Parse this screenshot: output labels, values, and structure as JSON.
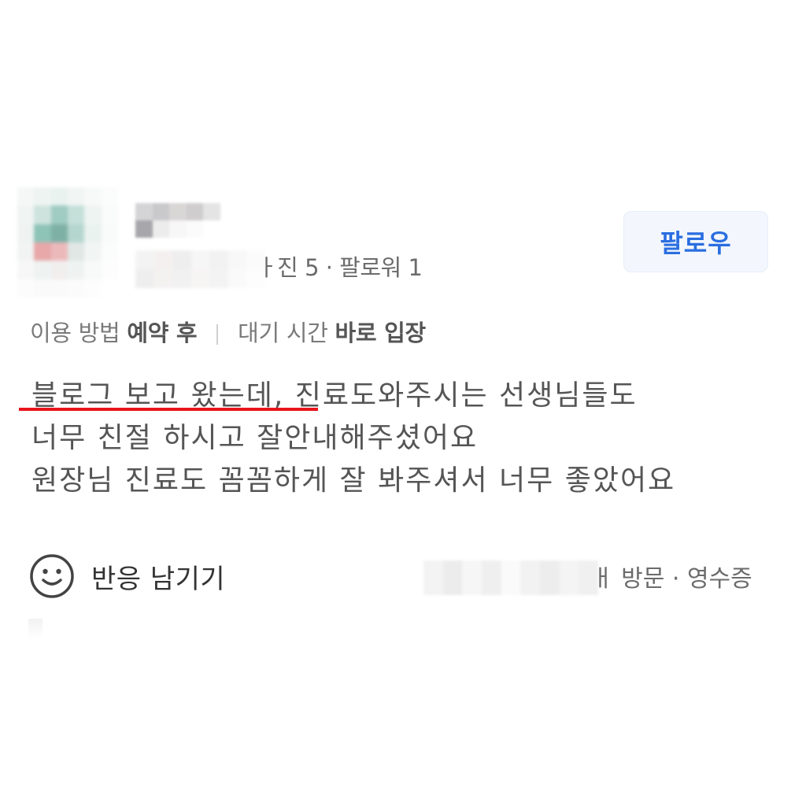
{
  "profile": {
    "stats_text": "사진 5 · 팔로워 1",
    "stats_visible": "ㅏ진 5 · 팔로워 1",
    "follow_label": "팔로우"
  },
  "info": {
    "method_label": "이용 방법",
    "method_value": "예약 후",
    "wait_label": "대기 시간",
    "wait_value": "바로 입장"
  },
  "review": {
    "lines": [
      "블로그 보고 왔는데, 진료도와주시는 선생님들도",
      "너무 친절 하시고 잘안내해주셨어요",
      "원장님 진료도 꼼꼼하게 잘 봐주셔서 너무 좋았어요"
    ]
  },
  "footer": {
    "react_label": "반응 남기기",
    "visit_text": "ㅐ 방문 · 영수증"
  },
  "colors": {
    "accent": "#2a6ee0",
    "underline": "#e8141c",
    "text_gray": "#555555"
  },
  "icons": {
    "react": "smile-icon"
  }
}
